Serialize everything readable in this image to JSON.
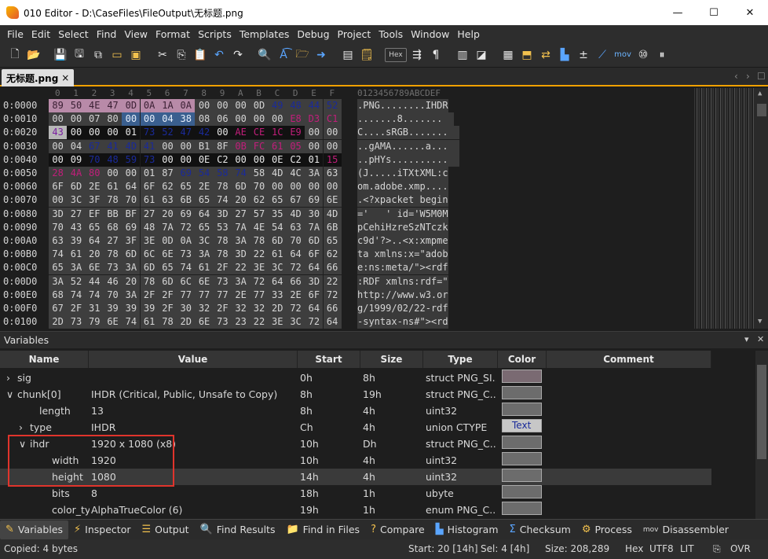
{
  "window": {
    "title": "010 Editor - D:\\CaseFiles\\FileOutput\\无标题.png",
    "minimize": "—",
    "maximize": "☐",
    "close": "✕"
  },
  "menu": [
    "File",
    "Edit",
    "Select",
    "Find",
    "View",
    "Format",
    "Scripts",
    "Templates",
    "Debug",
    "Project",
    "Tools",
    "Window",
    "Help"
  ],
  "toolbar": {
    "hex_label": "Hex",
    "mov_label": "mov",
    "icons": [
      "new-file-icon",
      "open-folder-icon",
      "save-icon",
      "save-as-icon",
      "save-all-icon",
      "folder-icon",
      "folders-icon",
      "cut-icon",
      "copy-icon",
      "paste-icon",
      "undo-icon",
      "redo-icon",
      "find-icon",
      "replace-icon",
      "find-in-files-icon",
      "goto-icon",
      "bookmark-icon",
      "template-icon",
      "hex-toggle",
      "columns-icon",
      "pilcrow-icon",
      "split-icon",
      "highlight-icon",
      "calculator-icon",
      "export-icon",
      "compare-icon",
      "histogram-icon",
      "operations-icon",
      "move-icon",
      "base-convert-icon",
      "pause-icon"
    ]
  },
  "tab": {
    "label": "无标题.png",
    "close": "×"
  },
  "hex": {
    "columns": [
      "0",
      "1",
      "2",
      "3",
      "4",
      "5",
      "6",
      "7",
      "8",
      "9",
      "A",
      "B",
      "C",
      "D",
      "E",
      "F"
    ],
    "ascii_header": "0123456789ABCDEF",
    "rows": [
      {
        "addr": "0:0000",
        "bytes": [
          "89",
          "50",
          "4E",
          "47",
          "0D",
          "0A",
          "1A",
          "0A",
          "00",
          "00",
          "00",
          "0D",
          "49",
          "48",
          "44",
          "52"
        ],
        "ascii": ".PNG........IHDR"
      },
      {
        "addr": "0:0010",
        "bytes": [
          "00",
          "00",
          "07",
          "80",
          "00",
          "00",
          "04",
          "38",
          "08",
          "06",
          "00",
          "00",
          "00",
          "E8",
          "D3",
          "C1"
        ],
        "ascii": ".......8.......  "
      },
      {
        "addr": "0:0020",
        "bytes": [
          "43",
          "00",
          "00",
          "00",
          "01",
          "73",
          "52",
          "47",
          "42",
          "00",
          "AE",
          "CE",
          "1C",
          "E9",
          "00",
          "00"
        ],
        "ascii": "C....sRGB.......  "
      },
      {
        "addr": "0:0030",
        "bytes": [
          "00",
          "04",
          "67",
          "41",
          "4D",
          "41",
          "00",
          "00",
          "B1",
          "8F",
          "0B",
          "FC",
          "61",
          "05",
          "00",
          "00"
        ],
        "ascii": "..gAMA......a...  "
      },
      {
        "addr": "0:0040",
        "bytes": [
          "00",
          "09",
          "70",
          "48",
          "59",
          "73",
          "00",
          "00",
          "0E",
          "C2",
          "00",
          "00",
          "0E",
          "C2",
          "01",
          "15"
        ],
        "ascii": "..pHYs..........  "
      },
      {
        "addr": "0:0050",
        "bytes": [
          "28",
          "4A",
          "80",
          "00",
          "00",
          "01",
          "87",
          "69",
          "54",
          "58",
          "74",
          "58",
          "4D",
          "4C",
          "3A",
          "63"
        ],
        "ascii": "(J.....iTXtXML:c"
      },
      {
        "addr": "0:0060",
        "bytes": [
          "6F",
          "6D",
          "2E",
          "61",
          "64",
          "6F",
          "62",
          "65",
          "2E",
          "78",
          "6D",
          "70",
          "00",
          "00",
          "00",
          "00"
        ],
        "ascii": "om.adobe.xmp...."
      },
      {
        "addr": "0:0070",
        "bytes": [
          "00",
          "3C",
          "3F",
          "78",
          "70",
          "61",
          "63",
          "6B",
          "65",
          "74",
          "20",
          "62",
          "65",
          "67",
          "69",
          "6E"
        ],
        "ascii": ".<?xpacket begin"
      },
      {
        "addr": "0:0080",
        "bytes": [
          "3D",
          "27",
          "EF",
          "BB",
          "BF",
          "27",
          "20",
          "69",
          "64",
          "3D",
          "27",
          "57",
          "35",
          "4D",
          "30",
          "4D"
        ],
        "ascii": "='   ' id='W5M0M"
      },
      {
        "addr": "0:0090",
        "bytes": [
          "70",
          "43",
          "65",
          "68",
          "69",
          "48",
          "7A",
          "72",
          "65",
          "53",
          "7A",
          "4E",
          "54",
          "63",
          "7A",
          "6B"
        ],
        "ascii": "pCehiHzreSzNTczk"
      },
      {
        "addr": "0:00A0",
        "bytes": [
          "63",
          "39",
          "64",
          "27",
          "3F",
          "3E",
          "0D",
          "0A",
          "3C",
          "78",
          "3A",
          "78",
          "6D",
          "70",
          "6D",
          "65"
        ],
        "ascii": "c9d'?>..<x:xmpme"
      },
      {
        "addr": "0:00B0",
        "bytes": [
          "74",
          "61",
          "20",
          "78",
          "6D",
          "6C",
          "6E",
          "73",
          "3A",
          "78",
          "3D",
          "22",
          "61",
          "64",
          "6F",
          "62"
        ],
        "ascii": "ta xmlns:x=\"adob"
      },
      {
        "addr": "0:00C0",
        "bytes": [
          "65",
          "3A",
          "6E",
          "73",
          "3A",
          "6D",
          "65",
          "74",
          "61",
          "2F",
          "22",
          "3E",
          "3C",
          "72",
          "64",
          "66"
        ],
        "ascii": "e:ns:meta/\"><rdf"
      },
      {
        "addr": "0:00D0",
        "bytes": [
          "3A",
          "52",
          "44",
          "46",
          "20",
          "78",
          "6D",
          "6C",
          "6E",
          "73",
          "3A",
          "72",
          "64",
          "66",
          "3D",
          "22"
        ],
        "ascii": ":RDF xmlns:rdf=\""
      },
      {
        "addr": "0:00E0",
        "bytes": [
          "68",
          "74",
          "74",
          "70",
          "3A",
          "2F",
          "2F",
          "77",
          "77",
          "77",
          "2E",
          "77",
          "33",
          "2E",
          "6F",
          "72"
        ],
        "ascii": "http://www.w3.or"
      },
      {
        "addr": "0:00F0",
        "bytes": [
          "67",
          "2F",
          "31",
          "39",
          "39",
          "39",
          "2F",
          "30",
          "32",
          "2F",
          "32",
          "32",
          "2D",
          "72",
          "64",
          "66"
        ],
        "ascii": "g/1999/02/22-rdf"
      },
      {
        "addr": "0:0100",
        "bytes": [
          "2D",
          "73",
          "79",
          "6E",
          "74",
          "61",
          "78",
          "2D",
          "6E",
          "73",
          "23",
          "22",
          "3E",
          "3C",
          "72",
          "64"
        ],
        "ascii": "-syntax-ns#\"><rd"
      }
    ]
  },
  "variables": {
    "title": "Variables",
    "pin": "▾",
    "close": "✕",
    "headers": {
      "name": "Name",
      "value": "Value",
      "start": "Start",
      "size": "Size",
      "type": "Type",
      "color": "Color",
      "comment": "Comment"
    },
    "rows": [
      {
        "expander": "›",
        "name": "sig",
        "value": "",
        "start": "0h",
        "size": "8h",
        "type": "struct PNG_SI...",
        "color": "pink"
      },
      {
        "expander": "∨",
        "name": "chunk[0]",
        "value": "IHDR  (Critical, Public, Unsafe to Copy)",
        "start": "8h",
        "size": "19h",
        "type": "struct PNG_C...",
        "color": "gray"
      },
      {
        "expander": "",
        "name": "length",
        "value": "13",
        "start": "8h",
        "size": "4h",
        "type": "uint32",
        "color": "gray"
      },
      {
        "expander": "›",
        "name": "type",
        "value": "IHDR",
        "start": "Ch",
        "size": "4h",
        "type": "union CTYPE",
        "color": "text",
        "color_label": "Text"
      },
      {
        "expander": "∨",
        "name": "ihdr",
        "value": "1920 x 1080 (x8)",
        "start": "10h",
        "size": "Dh",
        "type": "struct PNG_C...",
        "color": "gray"
      },
      {
        "expander": "",
        "name": "width",
        "value": "1920",
        "start": "10h",
        "size": "4h",
        "type": "uint32",
        "color": "gray"
      },
      {
        "expander": "",
        "name": "height",
        "value": "1080",
        "start": "14h",
        "size": "4h",
        "type": "uint32",
        "color": "gray"
      },
      {
        "expander": "",
        "name": "bits",
        "value": "8",
        "start": "18h",
        "size": "1h",
        "type": "ubyte",
        "color": "gray"
      },
      {
        "expander": "",
        "name": "color_type",
        "value": "AlphaTrueColor (6)",
        "start": "19h",
        "size": "1h",
        "type": "enum PNG_C...",
        "color": "gray"
      }
    ]
  },
  "bottom_tabs": [
    {
      "label": "Variables",
      "icon": "variables-icon",
      "glyph": "✎"
    },
    {
      "label": "Inspector",
      "icon": "inspector-icon",
      "glyph": "⚡"
    },
    {
      "label": "Output",
      "icon": "output-icon",
      "glyph": "☰"
    },
    {
      "label": "Find Results",
      "icon": "find-results-icon",
      "glyph": "🔍"
    },
    {
      "label": "Find in Files",
      "icon": "find-in-files-icon",
      "glyph": "📁"
    },
    {
      "label": "Compare",
      "icon": "compare-icon",
      "glyph": "?"
    },
    {
      "label": "Histogram",
      "icon": "histogram-icon",
      "glyph": "▙"
    },
    {
      "label": "Checksum",
      "icon": "checksum-icon",
      "glyph": "Σ"
    },
    {
      "label": "Process",
      "icon": "process-icon",
      "glyph": "⚙"
    },
    {
      "label": "Disassembler",
      "icon": "disassembler-icon",
      "glyph": "mov"
    }
  ],
  "status": {
    "message": "Copied: 4 bytes",
    "start": "Start: 20 [14h]",
    "sel": "Sel: 4 [4h]",
    "size": "Size: 208,289",
    "mode": "Hex",
    "encoding": "UTF8",
    "endian": "LIT",
    "ovr": "OVR"
  }
}
